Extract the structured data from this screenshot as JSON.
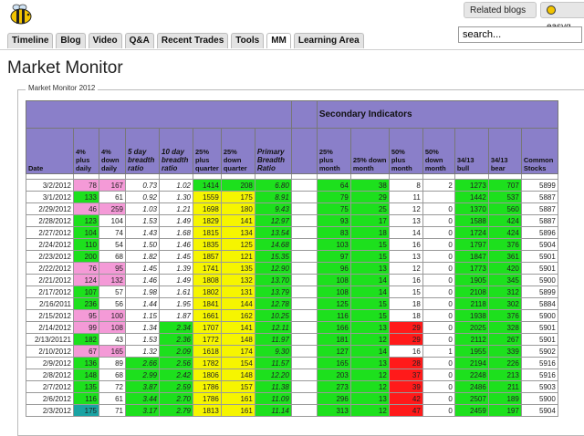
{
  "header": {
    "related_blogs": "Related blogs",
    "user_label": "easyg",
    "search_value": "search..."
  },
  "tabs": [
    "Timeline",
    "Blog",
    "Video",
    "Q&A",
    "Recent Trades",
    "Tools",
    "MM",
    "Learning Area"
  ],
  "active_tab": "MM",
  "page_title": "Market Monitor",
  "fieldset_legend": "Market Monitor 2012",
  "section_title": "Secondary Indicators",
  "columns": [
    "Date",
    "4% plus daily",
    "4% down daily",
    "5 day breadth ratio",
    "10 day breadth ratio",
    "25% plus quarter",
    "25% down quarter",
    "Primary Breadth Ratio",
    "",
    "25% plus month",
    "25% down month",
    "50% plus month",
    "50% down month",
    "34/13 bull",
    "34/13 bear",
    "Common Stocks"
  ],
  "colors": {
    "header": "#8a7fc9",
    "green": "#1de01d",
    "pink": "#f49ad7",
    "yellow": "#f6f500",
    "red": "#ff1a1a",
    "teal": "#1aa3a3"
  },
  "rows": [
    [
      "3/2/2012",
      "78",
      "167",
      "0.73",
      "1.02",
      "1414",
      "208",
      "6.80",
      "",
      "64",
      "38",
      "8",
      "2",
      "1273",
      "707",
      "5899"
    ],
    [
      "3/1/2012",
      "133",
      "61",
      "0.92",
      "1.30",
      "1559",
      "175",
      "8.91",
      "",
      "79",
      "29",
      "11",
      "",
      "1442",
      "537",
      "5887"
    ],
    [
      "2/29/2012",
      "46",
      "259",
      "1.03",
      "1.21",
      "1698",
      "180",
      "9.43",
      "",
      "75",
      "25",
      "12",
      "0",
      "1370",
      "560",
      "5887"
    ],
    [
      "2/28/2012",
      "123",
      "104",
      "1.53",
      "1.49",
      "1829",
      "141",
      "12.97",
      "",
      "93",
      "17",
      "13",
      "0",
      "1588",
      "424",
      "5887"
    ],
    [
      "2/27/2012",
      "104",
      "74",
      "1.43",
      "1.68",
      "1815",
      "134",
      "13.54",
      "",
      "83",
      "18",
      "14",
      "0",
      "1724",
      "424",
      "5896"
    ],
    [
      "2/24/2012",
      "110",
      "54",
      "1.50",
      "1.46",
      "1835",
      "125",
      "14.68",
      "",
      "103",
      "15",
      "16",
      "0",
      "1797",
      "376",
      "5904"
    ],
    [
      "2/23/2012",
      "200",
      "68",
      "1.82",
      "1.45",
      "1857",
      "121",
      "15.35",
      "",
      "97",
      "15",
      "13",
      "0",
      "1847",
      "361",
      "5901"
    ],
    [
      "2/22/2012",
      "76",
      "95",
      "1.45",
      "1.39",
      "1741",
      "135",
      "12.90",
      "",
      "96",
      "13",
      "12",
      "0",
      "1773",
      "420",
      "5901"
    ],
    [
      "2/21/2012",
      "124",
      "132",
      "1.46",
      "1.49",
      "1808",
      "132",
      "13.70",
      "",
      "108",
      "14",
      "16",
      "0",
      "1905",
      "345",
      "5900"
    ],
    [
      "2/17/2012",
      "107",
      "57",
      "1.98",
      "1.61",
      "1802",
      "131",
      "13.79",
      "",
      "108",
      "14",
      "15",
      "0",
      "2108",
      "312",
      "5899"
    ],
    [
      "2/16/2011",
      "236",
      "56",
      "1.44",
      "1.95",
      "1841",
      "144",
      "12.78",
      "",
      "125",
      "15",
      "18",
      "0",
      "2118",
      "302",
      "5884"
    ],
    [
      "2/15/2012",
      "95",
      "100",
      "1.15",
      "1.87",
      "1661",
      "162",
      "10.25",
      "",
      "116",
      "15",
      "18",
      "0",
      "1938",
      "376",
      "5900"
    ],
    [
      "2/14/2012",
      "99",
      "108",
      "1.34",
      "2.34",
      "1707",
      "141",
      "12.11",
      "",
      "166",
      "13",
      "29",
      "0",
      "2025",
      "328",
      "5901"
    ],
    [
      "2/13/20121",
      "182",
      "43",
      "1.53",
      "2.36",
      "1772",
      "148",
      "11.97",
      "",
      "181",
      "12",
      "29",
      "0",
      "2112",
      "267",
      "5901"
    ],
    [
      "2/10/2012",
      "67",
      "165",
      "1.32",
      "2.09",
      "1618",
      "174",
      "9.30",
      "",
      "127",
      "14",
      "16",
      "1",
      "1955",
      "339",
      "5902"
    ],
    [
      "2/9/2012",
      "136",
      "89",
      "2.66",
      "2.56",
      "1782",
      "154",
      "11.57",
      "",
      "165",
      "13",
      "28",
      "0",
      "2194",
      "226",
      "5916"
    ],
    [
      "2/8/2012",
      "148",
      "68",
      "2.99",
      "2.42",
      "1806",
      "148",
      "12.20",
      "",
      "203",
      "12",
      "37",
      "0",
      "2248",
      "213",
      "5916"
    ],
    [
      "2/7/2012",
      "135",
      "72",
      "3.87",
      "2.59",
      "1786",
      "157",
      "11.38",
      "",
      "273",
      "12",
      "39",
      "0",
      "2486",
      "211",
      "5903"
    ],
    [
      "2/6/2012",
      "116",
      "61",
      "3.44",
      "2.70",
      "1786",
      "161",
      "11.09",
      "",
      "296",
      "13",
      "42",
      "0",
      "2507",
      "189",
      "5900"
    ],
    [
      "2/3/2012",
      "175",
      "71",
      "3.17",
      "2.79",
      "1813",
      "161",
      "11.14",
      "",
      "313",
      "12",
      "47",
      "0",
      "2459",
      "197",
      "5904"
    ]
  ],
  "row_colors": [
    [
      "",
      "pk",
      "pk",
      "it",
      "it",
      "gr",
      "gr",
      "gr",
      "",
      "gr",
      "gr",
      "",
      "",
      "gr",
      "gr",
      ""
    ],
    [
      "",
      "gr",
      "",
      "it",
      "it",
      "ye",
      "ye",
      "gr",
      "",
      "gr",
      "gr",
      "",
      "",
      "gr",
      "gr",
      ""
    ],
    [
      "",
      "pk",
      "pk",
      "it",
      "it",
      "ye",
      "ye",
      "gr",
      "",
      "gr",
      "gr",
      "",
      "",
      "gr",
      "gr",
      ""
    ],
    [
      "",
      "gr",
      "",
      "it",
      "it",
      "ye",
      "ye",
      "gr",
      "",
      "gr",
      "gr",
      "",
      "",
      "gr",
      "gr",
      ""
    ],
    [
      "",
      "gr",
      "",
      "it",
      "it",
      "ye",
      "ye",
      "gr",
      "",
      "gr",
      "gr",
      "",
      "",
      "gr",
      "gr",
      ""
    ],
    [
      "",
      "gr",
      "",
      "it",
      "it",
      "ye",
      "ye",
      "gr",
      "",
      "gr",
      "gr",
      "",
      "",
      "gr",
      "gr",
      ""
    ],
    [
      "",
      "gr",
      "",
      "it",
      "it",
      "ye",
      "ye",
      "gr",
      "",
      "gr",
      "gr",
      "",
      "",
      "gr",
      "gr",
      ""
    ],
    [
      "",
      "pk",
      "pk",
      "it",
      "it",
      "ye",
      "ye",
      "gr",
      "",
      "gr",
      "gr",
      "",
      "",
      "gr",
      "gr",
      ""
    ],
    [
      "",
      "pk",
      "pk",
      "it",
      "it",
      "ye",
      "ye",
      "gr",
      "",
      "gr",
      "gr",
      "",
      "",
      "gr",
      "gr",
      ""
    ],
    [
      "",
      "gr",
      "",
      "it",
      "it",
      "ye",
      "ye",
      "gr",
      "",
      "gr",
      "gr",
      "",
      "",
      "gr",
      "gr",
      ""
    ],
    [
      "",
      "gr",
      "",
      "it",
      "it",
      "ye",
      "ye",
      "gr",
      "",
      "gr",
      "gr",
      "",
      "",
      "gr",
      "gr",
      ""
    ],
    [
      "",
      "pk",
      "pk",
      "it",
      "it",
      "ye",
      "ye",
      "gr",
      "",
      "gr",
      "gr",
      "",
      "",
      "gr",
      "gr",
      ""
    ],
    [
      "",
      "pk",
      "pk",
      "it",
      "gr",
      "ye",
      "ye",
      "gr",
      "",
      "gr",
      "gr",
      "rd",
      "",
      "gr",
      "gr",
      ""
    ],
    [
      "",
      "gr",
      "",
      "it",
      "gr",
      "ye",
      "ye",
      "gr",
      "",
      "gr",
      "gr",
      "rd",
      "",
      "gr",
      "gr",
      ""
    ],
    [
      "",
      "pk",
      "pk",
      "it",
      "gr",
      "ye",
      "ye",
      "gr",
      "",
      "gr",
      "gr",
      "",
      "",
      "gr",
      "gr",
      ""
    ],
    [
      "",
      "gr",
      "",
      "gr",
      "gr",
      "ye",
      "ye",
      "gr",
      "",
      "gr",
      "gr",
      "rd",
      "",
      "gr",
      "gr",
      ""
    ],
    [
      "",
      "gr",
      "",
      "gr",
      "gr",
      "ye",
      "ye",
      "gr",
      "",
      "gr",
      "gr",
      "rd",
      "",
      "gr",
      "gr",
      ""
    ],
    [
      "",
      "gr",
      "",
      "gr",
      "gr",
      "ye",
      "ye",
      "gr",
      "",
      "gr",
      "gr",
      "rd",
      "",
      "gr",
      "gr",
      ""
    ],
    [
      "",
      "gr",
      "",
      "gr",
      "gr",
      "ye",
      "ye",
      "gr",
      "",
      "gr",
      "gr",
      "rd",
      "",
      "gr",
      "gr",
      ""
    ],
    [
      "",
      "tl",
      "",
      "gr",
      "gr",
      "ye",
      "ye",
      "gr",
      "",
      "gr",
      "gr",
      "rd",
      "",
      "gr",
      "gr",
      ""
    ]
  ]
}
